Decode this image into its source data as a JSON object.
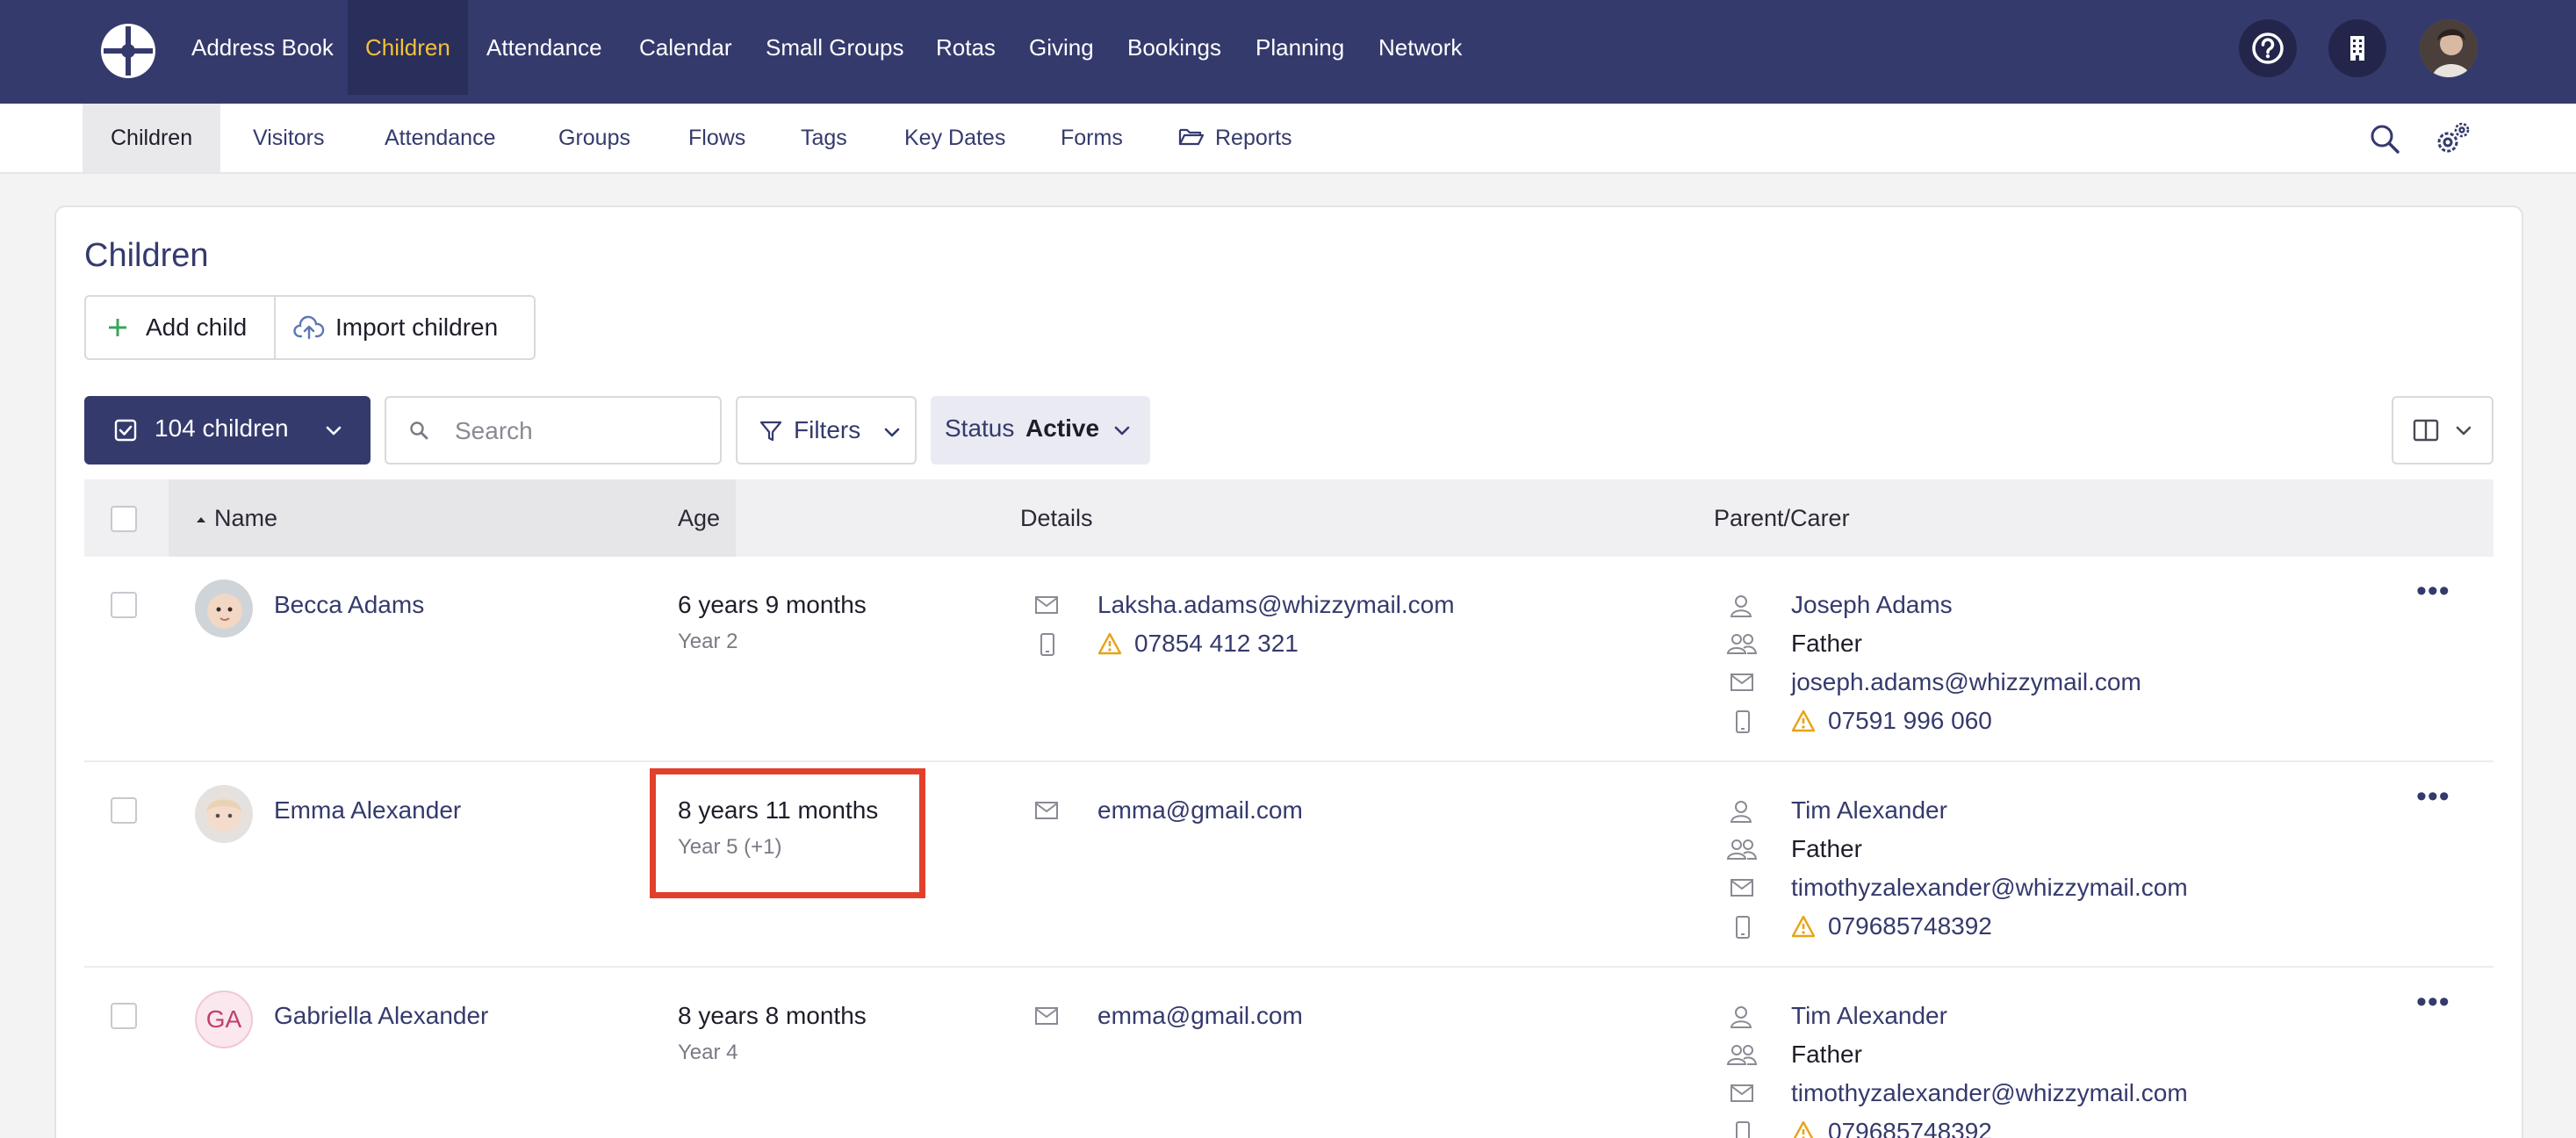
{
  "topnav": {
    "items": [
      "Address Book",
      "Children",
      "Attendance",
      "Calendar",
      "Small Groups",
      "Rotas",
      "Giving",
      "Bookings",
      "Planning",
      "Network"
    ],
    "active_index": 1
  },
  "subnav": {
    "items": [
      "Children",
      "Visitors",
      "Attendance",
      "Groups",
      "Flows",
      "Tags",
      "Key Dates",
      "Forms",
      "Reports"
    ],
    "active_index": 0
  },
  "page": {
    "title": "Children",
    "add_label": "Add child",
    "import_label": "Import children",
    "count_label": "104 children",
    "search_placeholder": "Search",
    "filters_label": "Filters",
    "status_label": "Status",
    "status_value": "Active"
  },
  "table": {
    "headers": {
      "name": "Name",
      "age": "Age",
      "details": "Details",
      "parent": "Parent/Carer"
    },
    "rows": [
      {
        "name": "Becca Adams",
        "age": "6 years 9 months",
        "year": "Year 2",
        "email": "Laksha.adams@whizzymail.com",
        "phone": "07854 412 321",
        "parent_name": "Joseph Adams",
        "parent_relation": "Father",
        "parent_email": "joseph.adams@whizzymail.com",
        "parent_phone": "07591 996 060"
      },
      {
        "name": "Emma Alexander",
        "age": "8 years 11 months",
        "year": "Year 5 (+1)",
        "email": "emma@gmail.com",
        "parent_name": "Tim Alexander",
        "parent_relation": "Father",
        "parent_email": "timothyzalexander@whizzymail.com",
        "parent_phone": "079685748392"
      },
      {
        "name": "Gabriella Alexander",
        "initials": "GA",
        "age": "8 years 8 months",
        "year": "Year 4",
        "email": "emma@gmail.com",
        "parent_name": "Tim Alexander",
        "parent_relation": "Father",
        "parent_email": "timothyzalexander@whizzymail.com",
        "parent_phone": "079685748392"
      }
    ]
  },
  "colors": {
    "brand": "#353a6d",
    "active_nav": "#f3c13a",
    "warning": "#e8a317",
    "highlight": "#e2402c"
  }
}
